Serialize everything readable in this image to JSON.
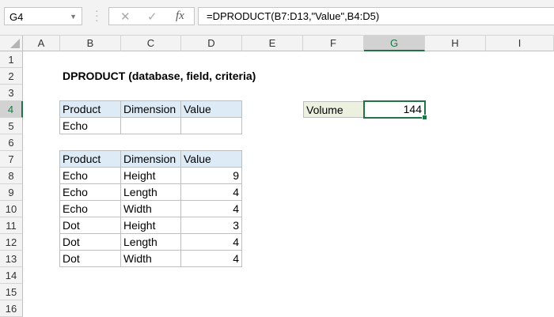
{
  "name_box": "G4",
  "formula": "=DPRODUCT(B7:D13,\"Value\",B4:D5)",
  "fx_icons": {
    "cancel": "✕",
    "enter": "✓",
    "fx": "fx"
  },
  "columns": [
    "A",
    "B",
    "C",
    "D",
    "E",
    "F",
    "G",
    "H",
    "I"
  ],
  "rows": [
    "1",
    "2",
    "3",
    "4",
    "5",
    "6",
    "7",
    "8",
    "9",
    "10",
    "11",
    "12",
    "13",
    "14",
    "15",
    "16"
  ],
  "selected": {
    "col": "G",
    "row": "4"
  },
  "title": "DPRODUCT (database, field, criteria)",
  "criteria": {
    "headers": [
      "Product",
      "Dimension",
      "Value"
    ],
    "row": [
      "Echo",
      "",
      ""
    ]
  },
  "database": {
    "headers": [
      "Product",
      "Dimension",
      "Value"
    ],
    "rows": [
      [
        "Echo",
        "Height",
        "9"
      ],
      [
        "Echo",
        "Length",
        "4"
      ],
      [
        "Echo",
        "Width",
        "4"
      ],
      [
        "Dot",
        "Height",
        "3"
      ],
      [
        "Dot",
        "Length",
        "4"
      ],
      [
        "Dot",
        "Width",
        "4"
      ]
    ]
  },
  "result": {
    "label": "Volume",
    "value": "144"
  },
  "colors": {
    "accent": "#217346",
    "header_fill": "#ddebf7",
    "label_fill": "#ebf1de"
  }
}
